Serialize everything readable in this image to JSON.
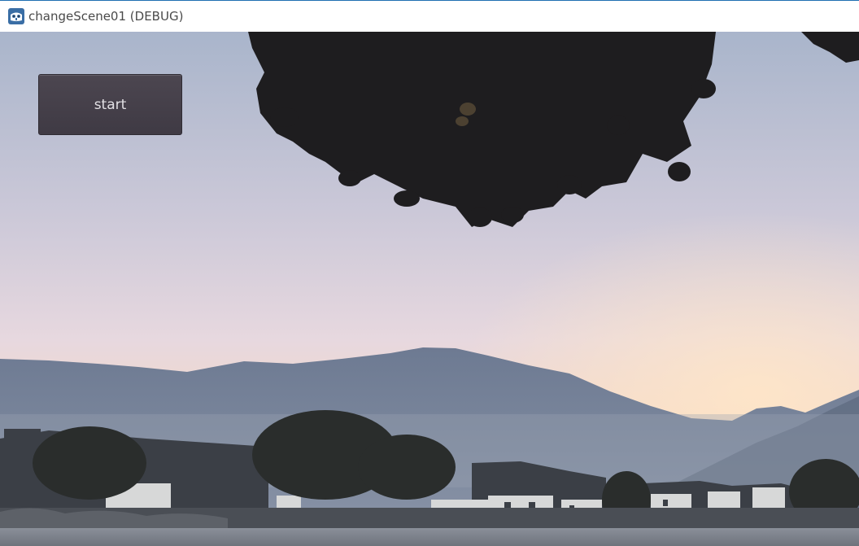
{
  "window": {
    "title": "changeScene01 (DEBUG)",
    "icon": "godot-engine-icon"
  },
  "scene": {
    "background": "misty-mountain-village-sunrise",
    "start_button_label": "start"
  },
  "colors": {
    "sky_top": "#a8b3c8",
    "sky_bottom": "#f3d5c0",
    "mountain": "#6f7c93",
    "foliage": "#1f1e20",
    "button_bg": "#46404b",
    "button_text": "#e2e0e4"
  }
}
